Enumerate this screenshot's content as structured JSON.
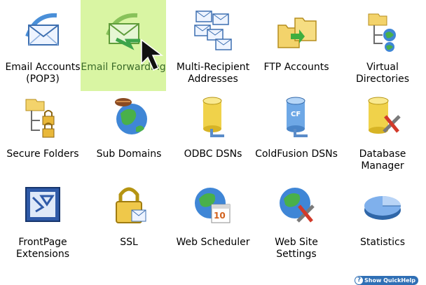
{
  "tiles": [
    {
      "label": "Email Accounts (POP3)",
      "icon": "email-accounts-icon"
    },
    {
      "label": "Email Forwarding",
      "icon": "email-forwarding-icon"
    },
    {
      "label": "Multi-Recipient Addresses",
      "icon": "multi-recipient-icon"
    },
    {
      "label": "FTP Accounts",
      "icon": "ftp-folders-icon"
    },
    {
      "label": "Virtual Directories",
      "icon": "virtual-directories-icon"
    },
    {
      "label": "Secure Folders",
      "icon": "secure-folders-icon"
    },
    {
      "label": "Sub Domains",
      "icon": "sub-domains-globe-icon"
    },
    {
      "label": "ODBC DSNs",
      "icon": "odbc-database-icon"
    },
    {
      "label": "ColdFusion DSNs",
      "icon": "coldfusion-database-icon"
    },
    {
      "label": "Database Manager",
      "icon": "database-manager-icon"
    },
    {
      "label": "FrontPage Extensions",
      "icon": "frontpage-icon"
    },
    {
      "label": "SSL",
      "icon": "ssl-lock-icon"
    },
    {
      "label": "Web Scheduler",
      "icon": "web-scheduler-icon"
    },
    {
      "label": "Web Site Settings",
      "icon": "web-site-settings-icon"
    },
    {
      "label": "Statistics",
      "icon": "statistics-pie-icon"
    }
  ],
  "selected_index": 1,
  "quickhelp_label": "Show QuickHelp",
  "colors": {
    "selected_bg": "#d9f5a3",
    "quickhelp_bg": "#2f6fb5"
  }
}
